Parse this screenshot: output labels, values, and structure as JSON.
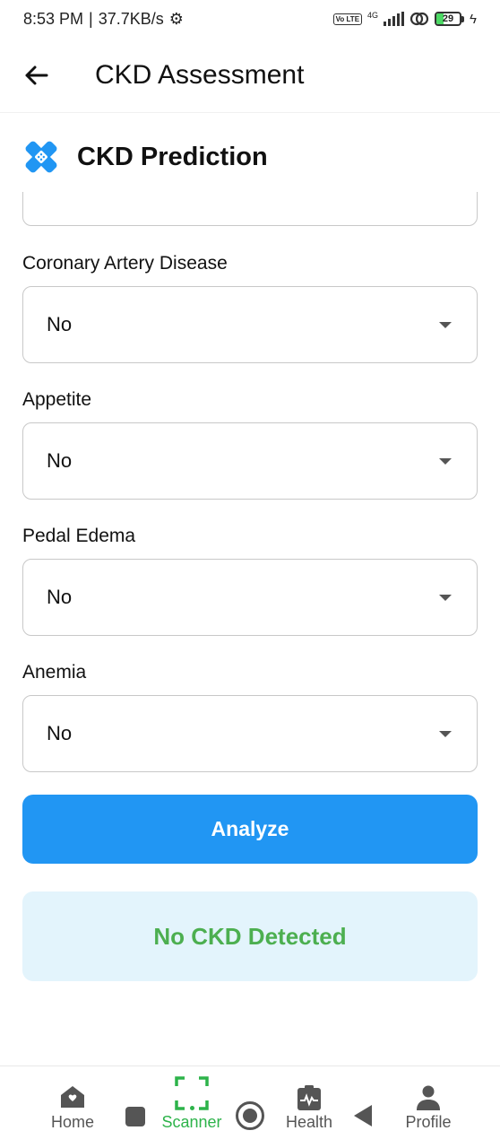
{
  "status_bar": {
    "time": "8:53 PM",
    "separator": "|",
    "speed": "37.7KB/s",
    "network": "4G",
    "volte": "Vo LTE",
    "battery": "29",
    "battery_level": 0.29
  },
  "app_bar": {
    "title": "CKD Assessment",
    "back_icon": "arrow-left-icon"
  },
  "header": {
    "title": "CKD Prediction",
    "icon": "bandage-icon",
    "icon_color": "#2196f3"
  },
  "form": {
    "fields": [
      {
        "label": "Coronary Artery Disease",
        "value": "No"
      },
      {
        "label": "Appetite",
        "value": "No"
      },
      {
        "label": "Pedal Edema",
        "value": "No"
      },
      {
        "label": "Anemia",
        "value": "No"
      }
    ],
    "analyze_label": "Analyze",
    "button_color": "#2196f3"
  },
  "result": {
    "text": "No CKD Detected",
    "text_color": "#4caf50",
    "background": "#e3f4fc"
  },
  "bottom_nav": {
    "items": [
      {
        "label": "Home",
        "icon": "home-icon"
      },
      {
        "label": "Scanner",
        "icon": "scanner-icon",
        "active": true
      },
      {
        "label": "Health",
        "icon": "health-icon"
      },
      {
        "label": "Profile",
        "icon": "person-icon"
      }
    ],
    "active_color": "#2db34a"
  }
}
